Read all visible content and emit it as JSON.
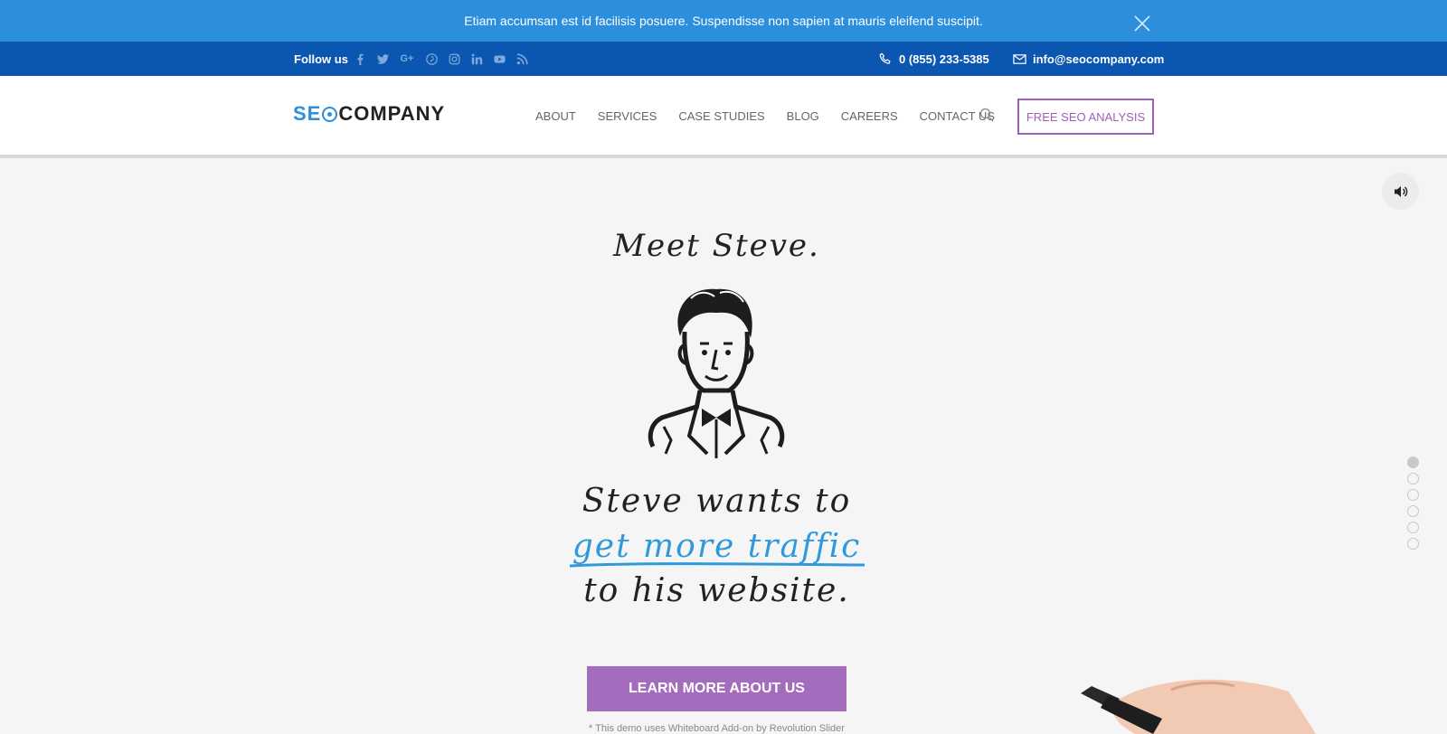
{
  "notice": {
    "text": "Etiam accumsan est id facilisis posuere. Suspendisse non sapien at mauris eleifend suscipit.",
    "close_icon": "close-icon"
  },
  "topbar": {
    "follow_label": "Follow us",
    "socials": [
      {
        "name": "facebook-icon",
        "glyph": "f"
      },
      {
        "name": "twitter-icon",
        "glyph": "t"
      },
      {
        "name": "google-plus-icon",
        "glyph": "G+"
      },
      {
        "name": "pinterest-icon",
        "glyph": "p"
      },
      {
        "name": "instagram-icon",
        "glyph": "ig"
      },
      {
        "name": "linkedin-icon",
        "glyph": "in"
      },
      {
        "name": "youtube-icon",
        "glyph": "yt"
      },
      {
        "name": "rss-icon",
        "glyph": "rss"
      }
    ],
    "phone": "0 (855) 233-5385",
    "email": "info@seocompany.com"
  },
  "header": {
    "logo_seo": "SE",
    "logo_company": "COMPANY",
    "nav": [
      "ABOUT",
      "SERVICES",
      "CASE STUDIES",
      "BLOG",
      "CAREERS",
      "CONTACT US"
    ],
    "cta_label": "FREE SEO ANALYSIS"
  },
  "hero": {
    "meet": "Meet Steve.",
    "line1": "Steve wants to",
    "line2": "get more traffic",
    "line3": "to his website.",
    "cta_label": "LEARN MORE ABOUT US",
    "demo_note": "* This demo uses Whiteboard Add-on by Revolution Slider",
    "slide_count": 6,
    "active_slide": 1
  },
  "colors": {
    "notice_bg": "#2b8fdd",
    "topbar_bg": "#0a56b0",
    "accent_purple": "#a36cbd",
    "accent_blue": "#2f99db"
  }
}
